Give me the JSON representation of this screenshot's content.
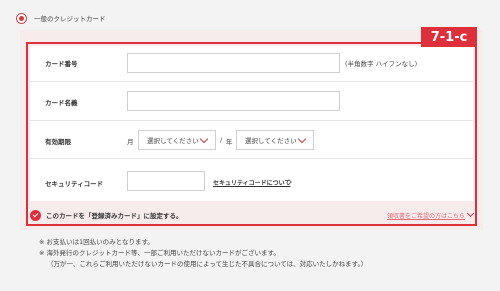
{
  "payment_option": {
    "label": "一般のクレジットカード"
  },
  "tag": "7-1-c",
  "form": {
    "card_number": {
      "label": "カード番号",
      "value": "",
      "placeholder": "",
      "note": "(半角数字 ハイフンなし)"
    },
    "card_name": {
      "label": "カード名義",
      "value": "",
      "placeholder": ""
    },
    "expiry": {
      "label": "有効期限",
      "month_unit": "月",
      "month_select": "選択してください",
      "separator": "/",
      "year_unit": "年",
      "year_select": "選択してください"
    },
    "security": {
      "label": "セキュリティコード",
      "value": "",
      "placeholder": "",
      "link": "セキュリティコードについて"
    }
  },
  "save_card": {
    "label": "このカードを「登録済みカード」に設定する。",
    "checked": true
  },
  "receipt_link": "領収書をご希望の方はこちら",
  "notes": [
    "※ お支払いは1回払いのみとなります。",
    "※ 海外発行のクレジットカード等、一部ご利用いただけないカードがございます。",
    "（万が一、これらご利用いただけないカードの使用によって生じた不具合については、対応いたしかねます。）"
  ],
  "colors": {
    "accent": "#de2f3d",
    "panel_bg": "#f7ecec",
    "page_bg": "#f3f3f3"
  }
}
